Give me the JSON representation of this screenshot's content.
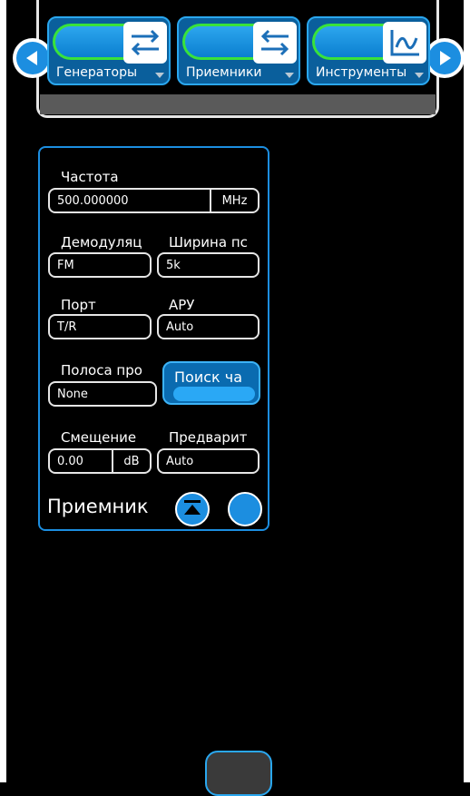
{
  "toolbar": {
    "prev_icon": "chevron-left-icon",
    "next_icon": "chevron-right-icon",
    "items": [
      {
        "label": "Генераторы",
        "icon": "swap-arrows-icon"
      },
      {
        "label": "Приемники",
        "icon": "reverse-arrows-icon"
      },
      {
        "label": "Инструменты",
        "icon": "waveform-icon"
      }
    ]
  },
  "receiver": {
    "title": "Приемник",
    "frequency": {
      "label": "Частота",
      "value": "500.000000",
      "unit": "MHz"
    },
    "demodulation": {
      "label": "Демодуляц",
      "value": "FM"
    },
    "bandwidth": {
      "label": "Ширина пс",
      "value": "5k"
    },
    "port": {
      "label": "Порт",
      "value": "T/R"
    },
    "agc": {
      "label": "АРУ",
      "value": "Auto"
    },
    "filter": {
      "label": "Полоса про",
      "value": "None"
    },
    "search_button": "Поиск ча",
    "offset": {
      "label": "Смещение",
      "value": "0.00",
      "unit": "dB"
    },
    "preamp": {
      "label": "Предварит",
      "value": "Auto"
    },
    "collapse_icon": "collapse-up-icon",
    "options_icon": "circle-icon"
  },
  "colors": {
    "accent": "#1c8ee0",
    "highlight": "#39e23b",
    "background": "#000000"
  }
}
